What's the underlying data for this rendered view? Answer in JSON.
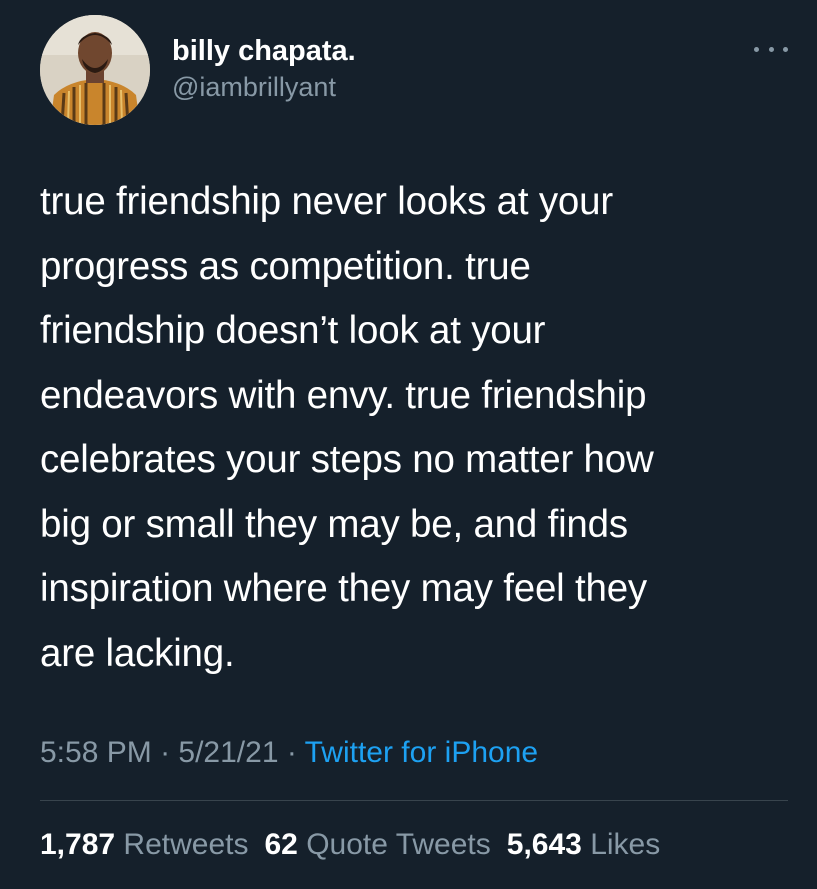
{
  "author": {
    "display_name": "billy chapata.",
    "handle": "@iambrillyant",
    "avatar_icon": "profile-photo"
  },
  "more_menu_icon": "more-horizontal-icon",
  "tweet": {
    "text": "true friendship never looks at your\nprogress as competition. true\nfriendship doesn’t look at your\nendeavors with envy. true friendship\ncelebrates your steps no matter how\nbig or small they may be, and finds\ninspiration where they may feel they\nare lacking.",
    "time": "5:58 PM",
    "separator1": " · ",
    "date": "5/21/21",
    "separator2": " · ",
    "source": "Twitter for iPhone"
  },
  "stats": {
    "retweets_count": "1,787",
    "retweets_label": "Retweets",
    "quotes_count": "62",
    "quotes_label": "Quote Tweets",
    "likes_count": "5,643",
    "likes_label": "Likes"
  },
  "colors": {
    "background": "#15202b",
    "primary_text": "#ffffff",
    "secondary_text": "#8899a6",
    "link": "#1da1f2",
    "divider": "#38444d"
  }
}
